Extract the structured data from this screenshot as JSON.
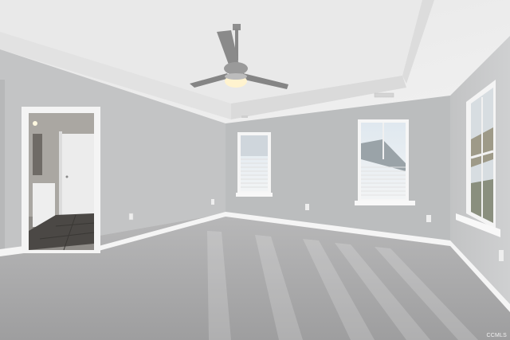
{
  "watermark": {
    "text": "CCMLS"
  },
  "colors": {
    "wall": "#bdbfc0",
    "ceiling": "#ebebeb",
    "trim": "#f7f7f7",
    "carpet": "#a9a9aa",
    "floor_tile": "#4a4744",
    "fan_metal": "#8c8c8c"
  }
}
